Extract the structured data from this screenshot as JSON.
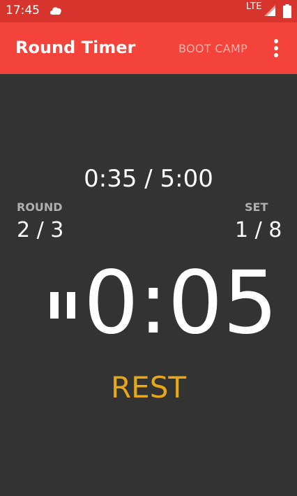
{
  "status_bar": {
    "time": "17:45",
    "network": "LTE",
    "icons": [
      "cloud-icon",
      "signal-icon",
      "battery-icon"
    ]
  },
  "app_bar": {
    "title": "Round Timer",
    "program": "BOOT CAMP",
    "menu_icon": "overflow-menu-icon"
  },
  "timer": {
    "elapsed": "0:35 / 5:00",
    "round_label": "ROUND",
    "round_value": "2 / 3",
    "set_label": "SET",
    "set_value": "1 / 8",
    "countdown": "0:05",
    "phase": "REST",
    "control_icon": "pause-icon"
  },
  "colors": {
    "status_bar": "#d6342c",
    "app_bar": "#f4433a",
    "background": "#333333",
    "phase": "#e6a817",
    "label": "#b0b0b0"
  }
}
